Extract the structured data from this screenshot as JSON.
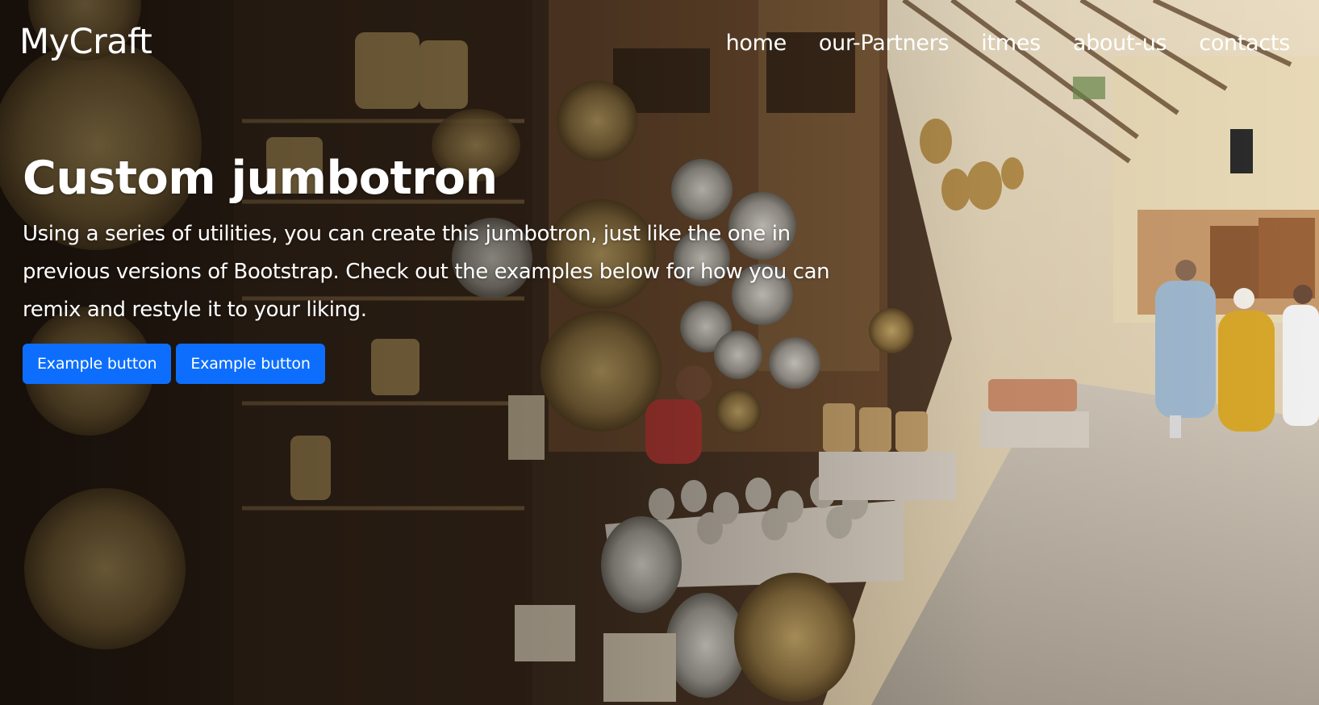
{
  "navbar": {
    "brand": "MyCraft",
    "links": [
      "home",
      "our-Partners",
      "itmes",
      "about-us",
      "contacts"
    ]
  },
  "jumbotron": {
    "title": "Custom jumbotron",
    "text": "Using a series of utilities, you can create this jumbotron, just like the one in previous versions of Bootstrap. Check out the examples below for how you can remix and restyle it to your liking.",
    "buttons": [
      "Example button",
      "Example button"
    ]
  },
  "colors": {
    "button": "#0d6efd",
    "text": "#ffffff"
  },
  "background": {
    "icon": "market-photo"
  }
}
